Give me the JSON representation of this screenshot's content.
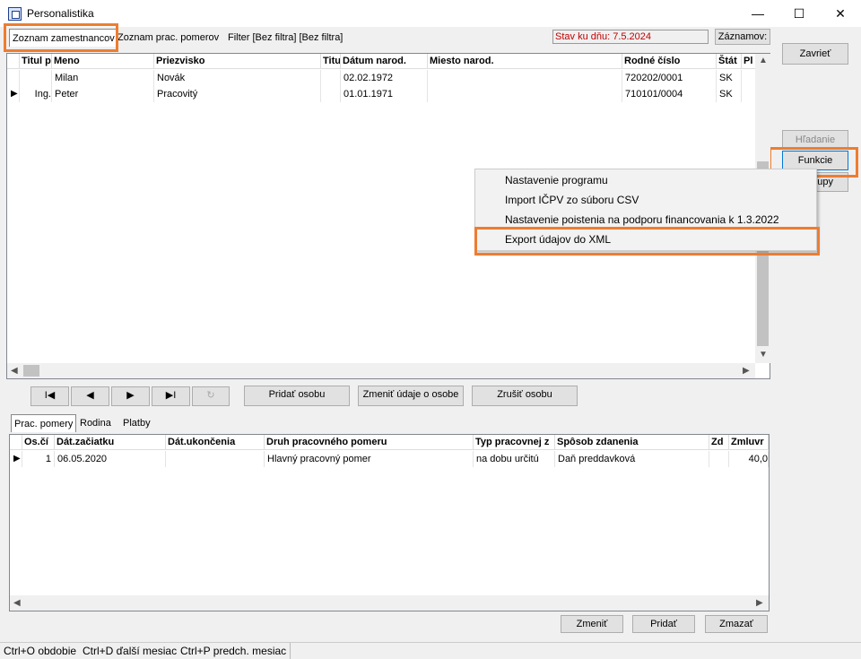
{
  "window": {
    "title": "Personalistika",
    "minimize": "—",
    "maximize": "☐",
    "close": "✕"
  },
  "top_tabs": [
    "Zoznam zamestnancov",
    "Zoznam prac. pomerov",
    "Filter [Bez filtra] [Bez filtra]"
  ],
  "stav": "Stav ku dňu: 7.5.2024",
  "zaznamov_label": "Záznamov:",
  "side_buttons": {
    "zavriet": "Zavrieť",
    "hladanie": "Hľadanie",
    "funkcie": "Funkcie",
    "partial": "upy"
  },
  "employees": {
    "columns": [
      "Titul p",
      "Meno",
      "Priezvisko",
      "Titu",
      "Dátum narod.",
      "Miesto narod.",
      "Rodné číslo",
      "Štát",
      "Pl"
    ],
    "rows": [
      [
        "",
        "Milan",
        "Novák",
        "",
        "02.02.1972",
        "",
        "720202/0001",
        "SK"
      ],
      [
        "Ing.",
        "Peter",
        "Pracovitý",
        "",
        "01.01.1971",
        "",
        "710101/0004",
        "SK"
      ]
    ]
  },
  "context_menu": [
    "Nastavenie programu",
    "Import IČPV zo súboru CSV",
    "Nastavenie poistenia na podporu financovania k 1.3.2022",
    "Export údajov do XML"
  ],
  "nav": {
    "first": "I◀",
    "prev": "◀",
    "next": "▶",
    "last": "▶I",
    "refresh": "↻",
    "pridat_osobu": "Pridať osobu",
    "zmenit_udaje": "Zmeniť údaje o osobe",
    "zrusit_osobu": "Zrušiť osobu"
  },
  "bottom_tabs": [
    "Prac. pomery",
    "Rodina",
    "Platby"
  ],
  "relations": {
    "columns": [
      "Os.čí",
      "Dát.začiatku",
      "Dát.ukončenia",
      "Druh pracovného pomeru",
      "Typ pracovnej z",
      "Spôsob zdanenia",
      "Zd",
      "Zmluvr"
    ],
    "rows": [
      [
        "1",
        "06.05.2020",
        "",
        "Hlavný pracovný pomer",
        "na dobu určitú",
        "Daň preddavková",
        "",
        "40,0"
      ]
    ]
  },
  "bottom_buttons": {
    "zmenit": "Zmeniť",
    "pridat": "Pridať",
    "zmazat": "Zmazať"
  },
  "statusbar": [
    "Ctrl+O obdobie",
    "Ctrl+D ďalší mesiac",
    "Ctrl+P predch. mesiac"
  ]
}
